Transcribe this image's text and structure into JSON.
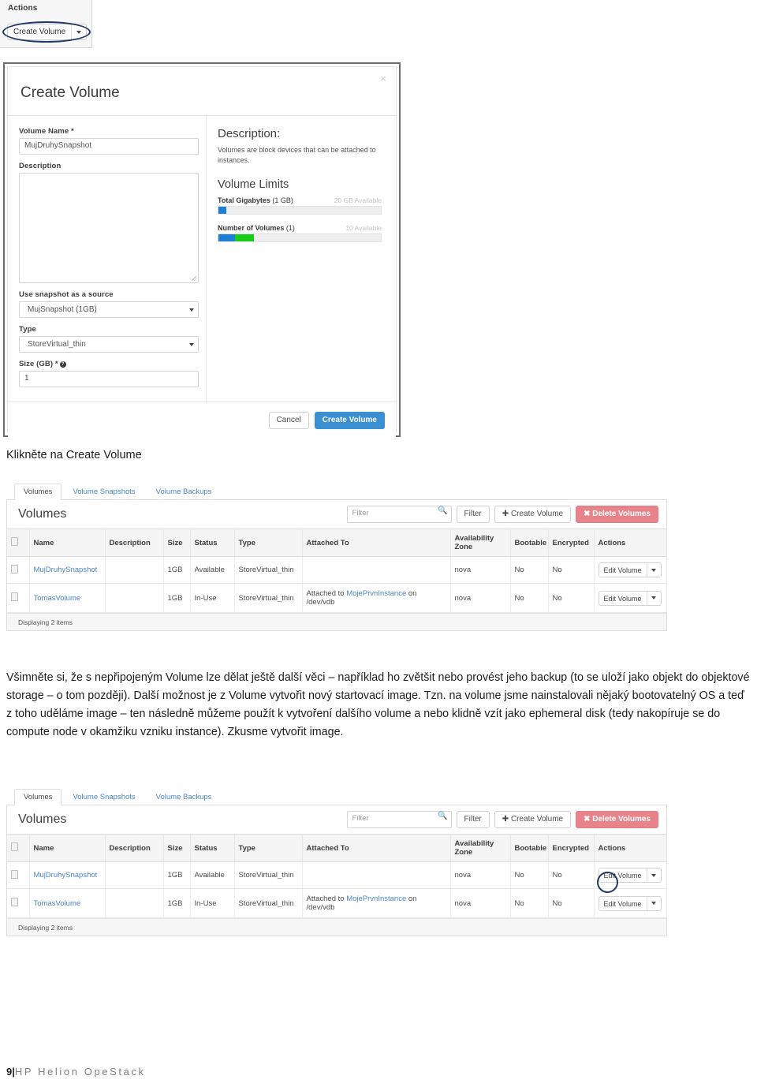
{
  "actions_panel": {
    "title": "Actions",
    "create_volume_button": "Create Volume",
    "caret_icon": "chevron-down-icon"
  },
  "modal": {
    "title": "Create Volume",
    "close_label": "×",
    "fields": {
      "volume_name_label": "Volume Name *",
      "volume_name_value": "MujDruhySnapshot",
      "description_label": "Description",
      "description_value": "",
      "snapshot_source_label": "Use snapshot as a source",
      "snapshot_source_value": "MujSnapshot (1GB)",
      "type_label": "Type",
      "type_value": "StoreVirtual_thin",
      "size_label": "Size (GB) *",
      "size_help_icon": "question-mark-icon",
      "size_value": "1"
    },
    "info": {
      "description_heading": "Description:",
      "description_text": "Volumes are block devices that can be attached to instances.",
      "limits_heading": "Volume Limits",
      "limits": [
        {
          "name": "Total Gigabytes",
          "current": "(1 GB)",
          "available": "20 GB Available",
          "segments": [
            {
              "color": "#1f7fd4",
              "percent": 5
            }
          ]
        },
        {
          "name": "Number of Volumes",
          "current": "(1)",
          "available": "10 Available",
          "segments": [
            {
              "color": "#1f7fd4",
              "percent": 10
            },
            {
              "color": "#18cc18",
              "percent": 12
            }
          ]
        }
      ]
    },
    "footer": {
      "cancel_label": "Cancel",
      "submit_label": "Create Volume",
      "submit_color": "#3a8fd2"
    }
  },
  "caption_1": "Klikněte na Create Volume",
  "volumes_panel": {
    "tabs": [
      {
        "label": "Volumes",
        "active": true
      },
      {
        "label": "Volume Snapshots",
        "active": false
      },
      {
        "label": "Volume Backups",
        "active": false
      }
    ],
    "heading": "Volumes",
    "filter_placeholder": "Filter",
    "search_icon": "search-icon",
    "filter_button": "Filter",
    "create_button": "Create Volume",
    "create_button_icon": "plus-icon",
    "delete_button": "Delete Volumes",
    "delete_button_icon": "cross-icon",
    "delete_button_color": "#e9838a",
    "columns": [
      "",
      "Name",
      "Description",
      "Size",
      "Status",
      "Type",
      "Attached To",
      "Availability Zone",
      "Bootable",
      "Encrypted",
      "Actions"
    ],
    "rows": [
      {
        "name": "MujDruhySnapshot",
        "description": "",
        "size": "1GB",
        "status": "Available",
        "type": "StoreVirtual_thin",
        "attached_prefix": "",
        "attached_link": "",
        "attached_suffix": "",
        "zone": "nova",
        "bootable": "No",
        "encrypted": "No",
        "action_label": "Edit Volume"
      },
      {
        "name": "TomasVolume",
        "description": "",
        "size": "1GB",
        "status": "In-Use",
        "type": "StoreVirtual_thin",
        "attached_prefix": "Attached to ",
        "attached_link": "MojePrvnInstance",
        "attached_suffix": " on /dev/vdb",
        "zone": "nova",
        "bootable": "No",
        "encrypted": "No",
        "action_label": "Edit Volume"
      }
    ],
    "footer_text": "Displaying 2 items"
  },
  "paragraph": "Všimněte si, že s nepřipojeným Volume lze dělat ještě další věci – například ho zvětšit nebo provést jeho backup (to se uloží jako objekt do objektové storage – o tom později). Další možnost je z Volume vytvořit nový startovací image. Tzn. na volume jsme nainstalovali nějaký bootovatelný OS a teď z toho uděláme image – ten následně můžeme použít k vytvoření dalšího volume a nebo klidně vzít jako ephemeral disk (tedy nakopíruje se do compute node v okamžiku vzniku instance). Zkusme vytvořit image.",
  "page_footer": {
    "page_number": "9",
    "separator": "|",
    "book_title": "HP Helion OpeStack"
  }
}
